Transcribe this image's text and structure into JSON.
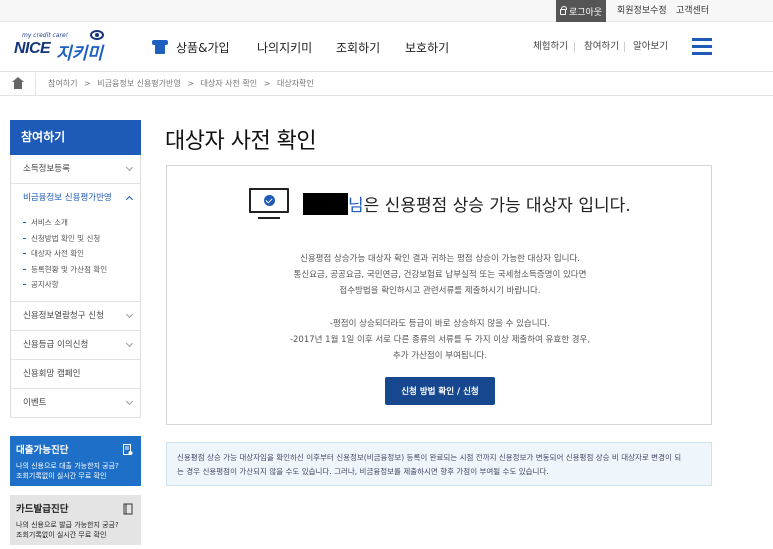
{
  "util": {
    "logout": "로그아웃",
    "edit_member": "회원정보수정",
    "customer_center": "고객센터"
  },
  "logo": {
    "tagline": "my credit care!",
    "brand_nice": "NICE",
    "brand_name": "지키미"
  },
  "gnb": {
    "products": "상품&가입",
    "my": "나의지키미",
    "inquiry": "조회하기",
    "protect": "보호하기"
  },
  "header_links": {
    "trial": "체험하기",
    "participate": "참여하기",
    "learn": "알아보기"
  },
  "breadcrumb": [
    "참여하기",
    "비금융정보 신용평가반영",
    "대상자 사전 확인",
    "대상자확인"
  ],
  "breadcrumb_sep": ">",
  "sidebar": {
    "title": "참여하기",
    "items": [
      {
        "label": "소득정보등록"
      },
      {
        "label": "비금융정보 신용평가반영"
      },
      {
        "label": "신용정보열람청구 신청"
      },
      {
        "label": "신용등급 이의신청"
      },
      {
        "label": "신용회망 캠페인"
      },
      {
        "label": "이벤트"
      }
    ],
    "subitems": [
      "서비스 소개",
      "신청방법 확인 및 신청",
      "대상자 사전 확인",
      "등록현황 및 가산점 확인",
      "공지사항"
    ]
  },
  "promos": [
    {
      "title": "대출가능진단",
      "line1": "나의 신용으로 대출 가능한지 궁금?",
      "line2": "조회기록없이 실시간 무료 확인"
    },
    {
      "title": "카드발급진단",
      "line1": "나의 신용으로 발급 가능한지 궁금?",
      "line2": "조회기록없이 실시간 무료 확인"
    }
  ],
  "main": {
    "title": "대상자 사전 확인",
    "headline_suffix": "님",
    "headline_rest": "은 신용평점 상승 가능 대상자 입니다.",
    "desc1": [
      "신용평점 상승가능 대상자 확인 결과 귀하는 평점 상승이 가능한 대상자 입니다.",
      "통신요금, 공공요금, 국민연금, 건강보험료 납부실적 또는 국세청소득증명이 있다면",
      "접수방법을 확인하시고 관련서류를 제출하시기 바랍니다."
    ],
    "desc2": [
      "-평점이 상승되더라도 등급이 바로 상승하지 않을 수 있습니다.",
      "-2017년 1월 1일 이후 서로 다른 종류의 서류를 두 가지 이상 제출하여 유효한 경우,",
      "추가 가산점이 부여됩니다."
    ],
    "cta": "신청 방법 확인 / 신청"
  },
  "notice": {
    "line1": "신용평점 상승 가능 대상자임을 확인하신 이후부터 신용정보(비금융정보) 등록이 완료되는 시점 전까지 신용정보가 변동되어 신용평점 상승 비 대상자로 변경이 되",
    "line2": "는 경우 신용평점이 가산되지 않을 수도 있습니다. 그러나, 비금융정보를 제출하시면 향후 가점이 부여될 수도 있습니다."
  },
  "colors": {
    "brand_blue": "#1e5ab8",
    "cta_blue": "#17488f",
    "notice_bg": "#eef6fb"
  }
}
